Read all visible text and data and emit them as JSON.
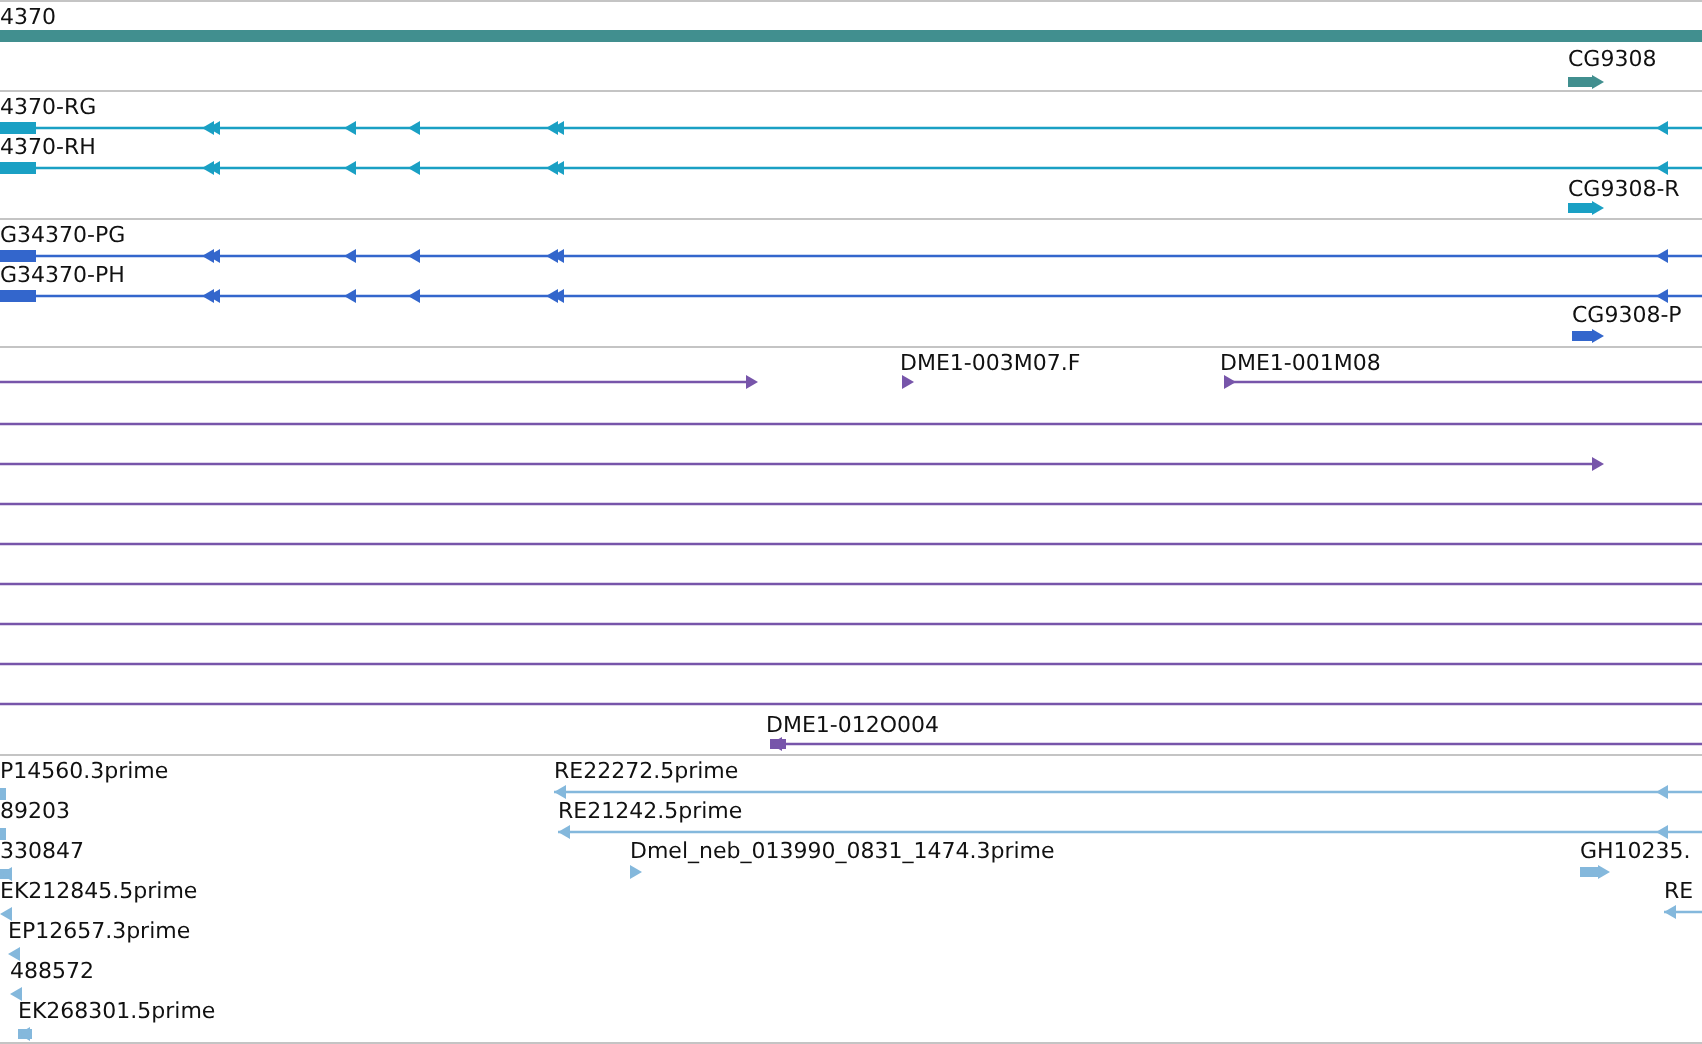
{
  "tracks": [
    {
      "kind": "gene",
      "features": [
        {
          "label": "4370"
        },
        {
          "label": "CG9308",
          "reverse": false
        }
      ]
    },
    {
      "kind": "transcript",
      "features": [
        {
          "label": "4370-RG",
          "reverse": true
        },
        {
          "label": "4370-RH",
          "reverse": true
        },
        {
          "label": "CG9308-R",
          "reverse": false
        }
      ]
    },
    {
      "kind": "protein",
      "features": [
        {
          "label": "G34370-PG",
          "reverse": true
        },
        {
          "label": "G34370-PH",
          "reverse": true
        },
        {
          "label": "CG9308-P",
          "reverse": false
        }
      ]
    },
    {
      "kind": "alignment",
      "features": [
        {
          "kind": "line",
          "reverse": false
        },
        {
          "kind": "labeled",
          "label": "DME1-003M07.F",
          "reverse": false
        },
        {
          "kind": "labeled",
          "label": "DME1-001M08",
          "reverse": false
        },
        {
          "kind": "line"
        },
        {
          "kind": "line",
          "reverse": false
        },
        {
          "kind": "line"
        },
        {
          "kind": "line"
        },
        {
          "kind": "line"
        },
        {
          "kind": "line"
        },
        {
          "kind": "line"
        },
        {
          "kind": "line"
        },
        {
          "kind": "labeled",
          "label": "DME1-012O004",
          "reverse": true
        }
      ]
    },
    {
      "kind": "est",
      "features": [
        {
          "label": "P14560.3prime"
        },
        {
          "label": "89203"
        },
        {
          "label": "330847",
          "reverse": true
        },
        {
          "label": "EK212845.5prime",
          "reverse": true
        },
        {
          "label": "EP12657.3prime",
          "reverse": true
        },
        {
          "label": "488572",
          "reverse": true
        },
        {
          "label": "EK268301.5prime",
          "reverse": true
        },
        {
          "label": "RE22272.5prime",
          "reverse": true
        },
        {
          "label": "RE21242.5prime",
          "reverse": true
        },
        {
          "label": "Dmel_neb_013990_0831_1474.3prime",
          "reverse": false
        },
        {
          "label": "GH10235.",
          "reverse": false
        },
        {
          "label": "RE",
          "reverse": true
        }
      ]
    }
  ]
}
